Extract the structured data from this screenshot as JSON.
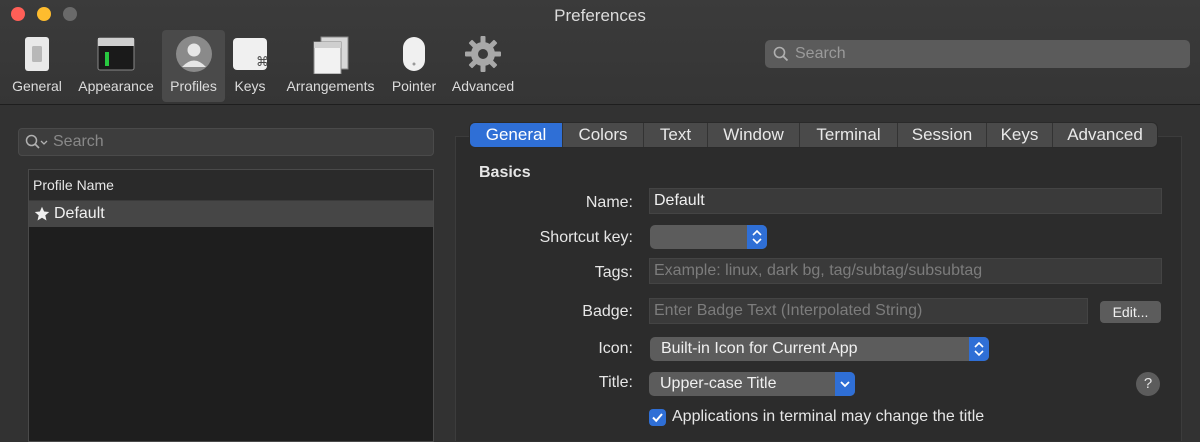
{
  "window": {
    "title": "Preferences"
  },
  "toolbar": {
    "items": [
      {
        "label": "General"
      },
      {
        "label": "Appearance"
      },
      {
        "label": "Profiles"
      },
      {
        "label": "Keys"
      },
      {
        "label": "Arrangements"
      },
      {
        "label": "Pointer"
      },
      {
        "label": "Advanced"
      }
    ],
    "selected": "Profiles",
    "search_placeholder": "Search"
  },
  "profiles": {
    "search_placeholder": "Search",
    "header": "Profile Name",
    "items": [
      {
        "name": "Default",
        "default": true
      }
    ]
  },
  "tabs": [
    "General",
    "Colors",
    "Text",
    "Window",
    "Terminal",
    "Session",
    "Keys",
    "Advanced"
  ],
  "active_tab": "General",
  "basics": {
    "heading": "Basics",
    "name_label": "Name:",
    "name_value": "Default",
    "shortcut_label": "Shortcut key:",
    "shortcut_value": "",
    "tags_label": "Tags:",
    "tags_placeholder": "Example: linux, dark bg, tag/subtag/subsubtag",
    "badge_label": "Badge:",
    "badge_placeholder": "Enter Badge Text (Interpolated String)",
    "badge_edit": "Edit...",
    "icon_label": "Icon:",
    "icon_value": "Built-in Icon for Current App",
    "title_label": "Title:",
    "title_value": "Upper-case Title",
    "help": "?",
    "apps_change_title": "Applications in terminal may change the title",
    "apps_change_title_checked": true
  },
  "colors": {
    "accent": "#2f6fd6",
    "window_bg": "#323232",
    "close": "#ff5f57",
    "minimize": "#febc2e"
  }
}
